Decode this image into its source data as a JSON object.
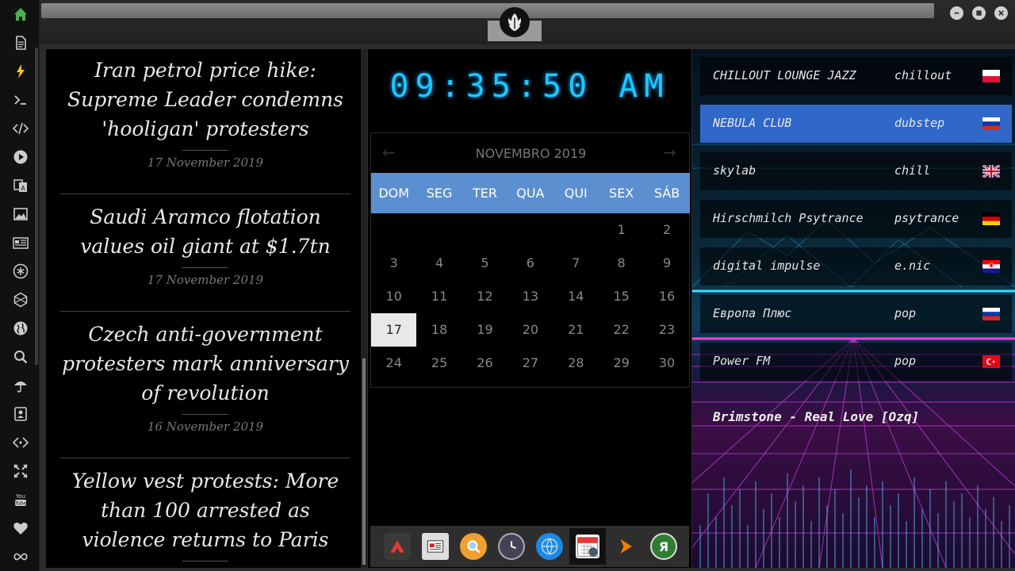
{
  "sidebar": {
    "items": [
      {
        "name": "home-icon"
      },
      {
        "name": "document-icon"
      },
      {
        "name": "lightning-icon"
      },
      {
        "name": "terminal-icon"
      },
      {
        "name": "code-icon"
      },
      {
        "name": "play-icon"
      },
      {
        "name": "translate-icon"
      },
      {
        "name": "image-icon"
      },
      {
        "name": "newspaper-icon"
      },
      {
        "name": "asterisk-icon"
      },
      {
        "name": "hexagon-icon"
      },
      {
        "name": "globe-icon"
      },
      {
        "name": "search-icon"
      },
      {
        "name": "umbrella-icon"
      },
      {
        "name": "contact-icon"
      },
      {
        "name": "code-brackets-icon"
      },
      {
        "name": "expand-icon"
      },
      {
        "name": "youtube-icon"
      },
      {
        "name": "heart-icon"
      },
      {
        "name": "infinity-icon"
      }
    ],
    "home_color": "#4caf50"
  },
  "news": {
    "items": [
      {
        "title": "Iran petrol price hike: Supreme Leader condemns 'hooligan' protesters",
        "date": "17 November 2019"
      },
      {
        "title": "Saudi Aramco flotation values oil giant at $1.7tn",
        "date": "17 November 2019"
      },
      {
        "title": "Czech anti-government protesters mark anniversary of revolution",
        "date": "16 November 2019"
      },
      {
        "title": "Yellow vest protests: More than 100 arrested as violence returns to Paris",
        "date": ""
      }
    ]
  },
  "clock": {
    "time": "09:35:50 AM",
    "color": "#1ec8ff"
  },
  "calendar": {
    "month_label": "NOVEMBRO 2019",
    "weekdays": [
      "DOM",
      "SEG",
      "TER",
      "QUA",
      "QUI",
      "SEX",
      "SÁB"
    ],
    "weeks": [
      [
        "",
        "",
        "",
        "",
        "",
        "1",
        "2"
      ],
      [
        "3",
        "4",
        "5",
        "6",
        "7",
        "8",
        "9"
      ],
      [
        "10",
        "11",
        "12",
        "13",
        "14",
        "15",
        "16"
      ],
      [
        "17",
        "18",
        "19",
        "20",
        "21",
        "22",
        "23"
      ],
      [
        "24",
        "25",
        "26",
        "27",
        "28",
        "29",
        "30"
      ]
    ],
    "today": "17",
    "header_color": "#5b8fd0"
  },
  "dock": {
    "items": [
      {
        "name": "dock-app-red"
      },
      {
        "name": "dock-app-news"
      },
      {
        "name": "dock-app-search"
      },
      {
        "name": "dock-app-clock"
      },
      {
        "name": "dock-app-globe"
      },
      {
        "name": "dock-app-calendar",
        "active": true
      },
      {
        "name": "dock-app-play"
      },
      {
        "name": "dock-app-yandex",
        "glyph": "Я"
      }
    ]
  },
  "radio": {
    "stations": [
      {
        "name": "CHILLOUT LOUNGE JAZZ",
        "genre": "chillout",
        "flag": "PL"
      },
      {
        "name": "NEBULA CLUB",
        "genre": "dubstep",
        "flag": "RU",
        "active": true
      },
      {
        "name": "skylab",
        "genre": "chill",
        "flag": "GB"
      },
      {
        "name": "Hirschmilch Psytrance",
        "genre": "psytrance",
        "flag": "DE"
      },
      {
        "name": "digital impulse",
        "genre": "e.nic",
        "flag": "HR"
      },
      {
        "name": "Европа Плюс",
        "genre": "pop",
        "flag": "RU"
      },
      {
        "name": "Power FM",
        "genre": "pop",
        "flag": "TR"
      }
    ],
    "now_playing": "Brimstone - Real Love [Ozq]",
    "active_color": "#2f68c8"
  }
}
